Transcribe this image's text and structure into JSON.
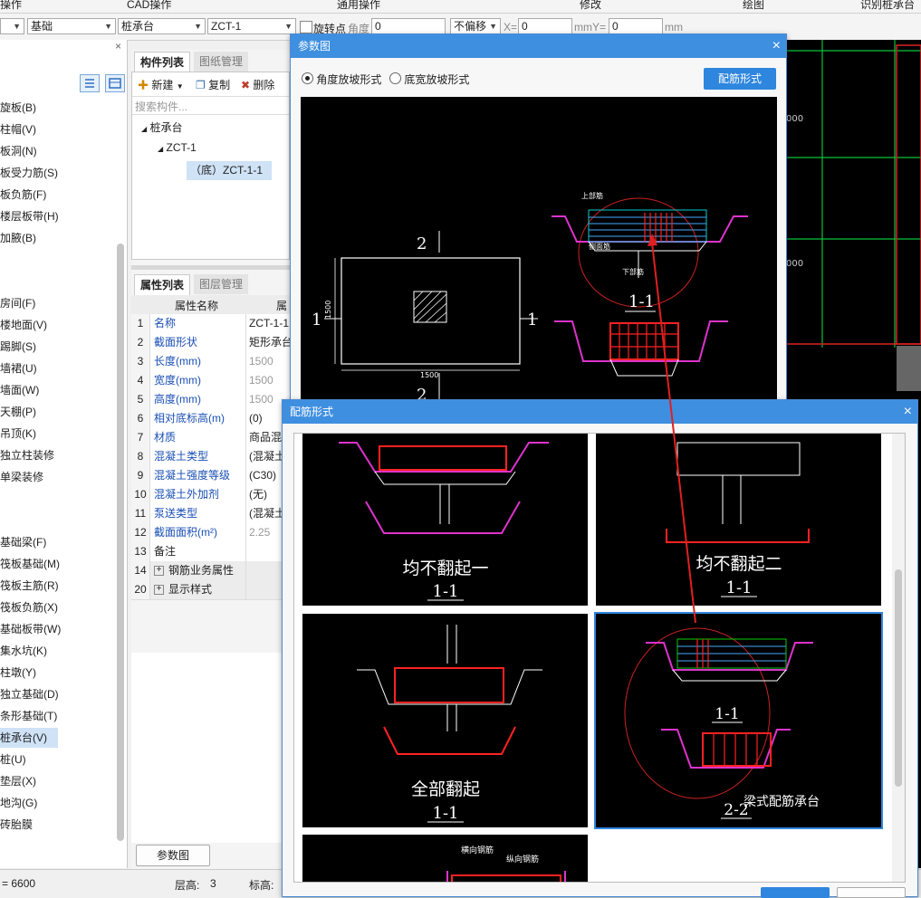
{
  "menubar": {
    "items": [
      "操作",
      "CAD操作",
      "通用操作",
      "修改",
      "绘图",
      "识别桩承台"
    ]
  },
  "toolbar": {
    "combo1": "",
    "combo2": "基础",
    "combo3": "桩承台",
    "combo4": "ZCT-1",
    "rotate_point_label": "旋转点",
    "angle_label": "角度",
    "angle_value": "0",
    "offset_value": "不偏移",
    "x_label": "X=",
    "x_value": "0",
    "mm_y_label": "mmY=",
    "y_value": "0",
    "mm_label": "mm"
  },
  "left_nav": {
    "items": [
      "旋板(B)",
      "柱帽(V)",
      "板洞(N)",
      "板受力筋(S)",
      "板负筋(F)",
      "楼层板带(H)",
      "加腋(B)",
      "",
      "",
      "房间(F)",
      "楼地面(V)",
      "踢脚(S)",
      "墙裙(U)",
      "墙面(W)",
      "天棚(P)",
      "吊顶(K)",
      "独立柱装修",
      "单梁装修",
      "",
      "",
      "基础梁(F)",
      "筏板基础(M)",
      "筏板主筋(R)",
      "筏板负筋(X)",
      "基础板带(W)",
      "集水坑(K)",
      "柱墩(Y)",
      "独立基础(D)",
      "条形基础(T)",
      "桩承台(V)",
      "桩(U)",
      "垫层(X)",
      "地沟(G)",
      "砖胎膜"
    ]
  },
  "component_list": {
    "tab_active": "构件列表",
    "tab_inactive": "图纸管理",
    "new_label": "新建",
    "copy_label": "复制",
    "delete_label": "删除",
    "search_placeholder": "搜索构件...",
    "tree_root": "桩承台",
    "tree_child": "ZCT-1",
    "tree_leaf": "（底）ZCT-1-1"
  },
  "properties": {
    "tab_active": "属性列表",
    "tab_inactive": "图层管理",
    "col_name": "属性名称",
    "col_value": "属",
    "rows": [
      {
        "n": "1",
        "name": "名称",
        "value": "ZCT-1-1"
      },
      {
        "n": "2",
        "name": "截面形状",
        "value": "矩形承台"
      },
      {
        "n": "3",
        "name": "长度(mm)",
        "value": "1500"
      },
      {
        "n": "4",
        "name": "宽度(mm)",
        "value": "1500"
      },
      {
        "n": "5",
        "name": "高度(mm)",
        "value": "1500"
      },
      {
        "n": "6",
        "name": "相对底标高(m)",
        "value": "(0)"
      },
      {
        "n": "7",
        "name": "材质",
        "value": "商品混凝"
      },
      {
        "n": "8",
        "name": "混凝土类型",
        "value": "(混凝土"
      },
      {
        "n": "9",
        "name": "混凝土强度等级",
        "value": "(C30)"
      },
      {
        "n": "10",
        "name": "混凝土外加剂",
        "value": "(无)"
      },
      {
        "n": "11",
        "name": "泵送类型",
        "value": "(混凝土"
      },
      {
        "n": "12",
        "name": "截面面积(m²)",
        "value": "2.25"
      },
      {
        "n": "13",
        "name": "备注",
        "value": ""
      },
      {
        "n": "14",
        "name": "钢筋业务属性",
        "value": ""
      },
      {
        "n": "20",
        "name": "显示样式",
        "value": ""
      }
    ],
    "param_button": "参数图"
  },
  "param_dialog": {
    "title": "参数图",
    "radio1": "角度放坡形式",
    "radio2": "底宽放坡形式",
    "rebar_button": "配筋形式",
    "plan_dim": "1500",
    "label_1": "1",
    "label_2": "2",
    "section_11": "1-1",
    "side_dim": "1500",
    "top_bar": "上部筋",
    "bottom_bar": "下部筋",
    "side_bar": "侧面筋"
  },
  "rebar_dialog": {
    "title": "配筋形式",
    "cards": [
      {
        "title": "均不翻起一",
        "section": "1-1"
      },
      {
        "title": "均不翻起二",
        "section": "1-1"
      },
      {
        "title": "全部翻起",
        "section": "1-1"
      },
      {
        "title": "梁式配筋承台",
        "section": "1-1",
        "section2": "2-2"
      }
    ],
    "partial_label1": "横向钢筋",
    "partial_label2": "纵向钢筋"
  },
  "status": {
    "left_value": "= 6600",
    "floor_height_label": "层高:",
    "floor_height_value": "3",
    "elevation_label": "标高:"
  }
}
